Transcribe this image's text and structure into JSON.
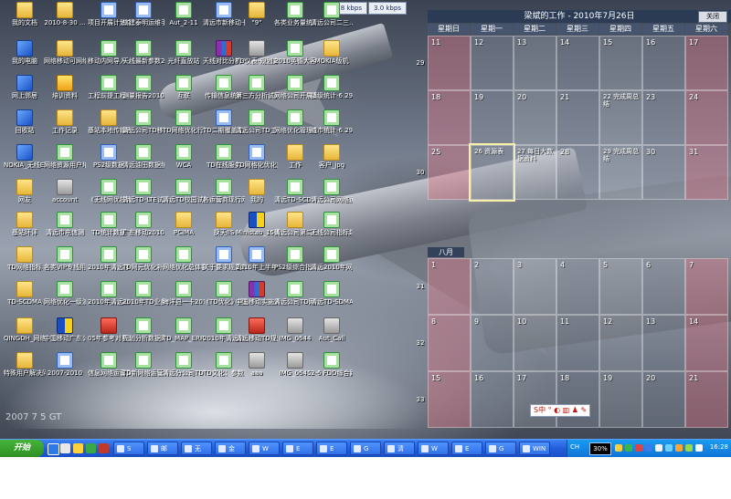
{
  "top_meters": {
    "speed1": "8.8 kbps",
    "speed2": "3.0 kbps"
  },
  "desktop_icons": [
    {
      "label": "我的文档",
      "type": "folder"
    },
    {
      "label": "2010-8-30 ...",
      "type": "folder"
    },
    {
      "label": "项目开展计划中...",
      "type": "word"
    },
    {
      "label": "辖建泰明运维手-01",
      "type": "word"
    },
    {
      "label": "Aut_2-11",
      "type": "excel"
    },
    {
      "label": "清远市新移动卡...",
      "type": "word"
    },
    {
      "label": "\"9\"",
      "type": "folder"
    },
    {
      "label": "各类业务量统计",
      "type": "excel"
    },
    {
      "label": "清远公司二三...",
      "type": "excel"
    },
    {
      "label": "我的电脑",
      "type": "app"
    },
    {
      "label": "网络移动可网络地址",
      "type": "folder"
    },
    {
      "label": "移动内网导入...",
      "type": "excel"
    },
    {
      "label": "天线最新参数2010-",
      "type": "excel"
    },
    {
      "label": "光纤直放站",
      "type": "excel"
    },
    {
      "label": "天线对比分析-2010",
      "type": "rar"
    },
    {
      "label": "TD仪表-规划方案 2",
      "type": "gray"
    },
    {
      "label": "2010英德大客户结果",
      "type": "excel"
    },
    {
      "label": "MOKIA版机",
      "type": "folder"
    },
    {
      "label": "网上邻居",
      "type": "app"
    },
    {
      "label": "培训资料",
      "type": "yellow"
    },
    {
      "label": "工程前提工程—...",
      "type": "excel"
    },
    {
      "label": "测量报告201008...",
      "type": "excel"
    },
    {
      "label": "互联",
      "type": "excel"
    },
    {
      "label": "传输信息统计",
      "type": "excel"
    },
    {
      "label": "第三方分析试分析报",
      "type": "excel"
    },
    {
      "label": "网络公司开展家庭...",
      "type": "excel"
    },
    {
      "label": "镇级统计-6.29用户",
      "type": "excel"
    },
    {
      "label": "回收站",
      "type": "app"
    },
    {
      "label": "工作记录",
      "type": "folder"
    },
    {
      "label": "基站本地传输表",
      "type": "folder"
    },
    {
      "label": "清远公司TD移动学院",
      "type": "excel"
    },
    {
      "label": "TD网络优化行动",
      "type": "excel"
    },
    {
      "label": "TD二期覆盖工程管理",
      "type": "word"
    },
    {
      "label": "清远公司TD工作网格",
      "type": "excel"
    },
    {
      "label": "网络优化管理信息",
      "type": "excel"
    },
    {
      "label": "城市统计-6.29用户",
      "type": "excel"
    },
    {
      "label": "NOKIA_无线E71指导",
      "type": "app"
    },
    {
      "label": "网络资源用户培训",
      "type": "excel"
    },
    {
      "label": "PS2级数据",
      "type": "word"
    },
    {
      "label": "清远油田数据统计",
      "type": "excel"
    },
    {
      "label": "WCA",
      "type": "excel"
    },
    {
      "label": "TD在线服务",
      "type": "excel"
    },
    {
      "label": "TD网格化优化对照",
      "type": "word"
    },
    {
      "label": "工作",
      "type": "folder"
    },
    {
      "label": "客户_jpg",
      "type": "folder"
    },
    {
      "label": "网友",
      "type": "folder"
    },
    {
      "label": "account",
      "type": "gray"
    },
    {
      "label": "《无线网优技术要求",
      "type": "excel"
    },
    {
      "label": "清远TD-LTE试网规划",
      "type": "excel"
    },
    {
      "label": "清远TD校园试网...",
      "type": "excel"
    },
    {
      "label": "各运营商现行网络...",
      "type": "excel"
    },
    {
      "label": "我的",
      "type": "folder"
    },
    {
      "label": "清远TD-SCDMA",
      "type": "excel"
    },
    {
      "label": "清远公司网络运维",
      "type": "excel"
    },
    {
      "label": "基站环评",
      "type": "folder"
    },
    {
      "label": "清远市电信测",
      "type": "excel"
    },
    {
      "label": "TD统计数据",
      "type": "excel"
    },
    {
      "label": "广东移动2010综合",
      "type": "excel"
    },
    {
      "label": "PCIMA",
      "type": "folder"
    },
    {
      "label": "换天IIS",
      "type": "folder"
    },
    {
      "label": "Ministab_15维修中文",
      "type": "flag"
    },
    {
      "label": "清远公司第二代半年终",
      "type": "folder"
    },
    {
      "label": "无线公司指标超标分析",
      "type": "excel"
    },
    {
      "label": "TD网络指标",
      "type": "folder"
    },
    {
      "label": "各类VIP专线用户管理",
      "type": "excel"
    },
    {
      "label": "2010年清远移动资费",
      "type": "excel"
    },
    {
      "label": "TD网元优化补充",
      "type": "excel"
    },
    {
      "label": "网络优化总体要求",
      "type": "excel"
    },
    {
      "label": "关于要求规范有关...",
      "type": "word"
    },
    {
      "label": "2010年上半年总结",
      "type": "word"
    },
    {
      "label": "PS2级综合指标2",
      "type": "excel"
    },
    {
      "label": "清远2010年网络...",
      "type": "excel"
    },
    {
      "label": "TD-SCDMA",
      "type": "folder"
    },
    {
      "label": "网络优化一级演练中",
      "type": "excel"
    },
    {
      "label": "2010年清远公司网络",
      "type": "excel"
    },
    {
      "label": "2010年TD业务指标",
      "type": "excel"
    },
    {
      "label": "海洋县一卡2010",
      "type": "excel"
    },
    {
      "label": "《TD优化》规范",
      "type": "excel"
    },
    {
      "label": "中国移动实施方案",
      "type": "rar"
    },
    {
      "label": "清远公司TD网络...",
      "type": "excel"
    },
    {
      "label": "清远TD-SDMA-0726",
      "type": "excel"
    },
    {
      "label": "QINGDH_网络优化中心",
      "type": "folder"
    },
    {
      "label": "中国移动广东公司...",
      "type": "flag"
    },
    {
      "label": "05年参考对手选择参考",
      "type": "red"
    },
    {
      "label": "规划分析数据网络管理",
      "type": "excel"
    },
    {
      "label": "TD_MAP_ERROR",
      "type": "excel"
    },
    {
      "label": "2010年清远公司资源",
      "type": "excel"
    },
    {
      "label": "清远移动TD规划",
      "type": "red"
    },
    {
      "label": "IMG_0644",
      "type": "gray"
    },
    {
      "label": "Aut_Call",
      "type": "gray"
    },
    {
      "label": "特殊用户解决问题",
      "type": "folder"
    },
    {
      "label": "2007-2010",
      "type": "word"
    },
    {
      "label": "信息网络运营第三批",
      "type": "excel"
    },
    {
      "label": "TD新网络运营第三批",
      "type": "excel"
    },
    {
      "label": "清远分公司TD资源...",
      "type": "excel"
    },
    {
      "label": "TD文化：参数手册",
      "type": "excel"
    },
    {
      "label": "aaa",
      "type": "gray"
    },
    {
      "label": "IMG_0645",
      "type": "gray"
    },
    {
      "label": "2-6 FDD综合路测结果",
      "type": "excel"
    }
  ],
  "calendar": {
    "title": "梁斌的工作 - 2010年7月26日",
    "close_label": "关闭",
    "weekdays": [
      "星期日",
      "星期一",
      "星期二",
      "星期三",
      "星期四",
      "星期五",
      "星期六"
    ],
    "july_weeks": [
      {
        "week": "29",
        "days": [
          "11",
          "12",
          "13",
          "14",
          "15",
          "16",
          "17"
        ]
      },
      {
        "week": "",
        "days": [
          "18",
          "19",
          "20",
          "21",
          "22",
          "23",
          "24"
        ]
      },
      {
        "week": "30",
        "days": [
          "25",
          "26",
          "27",
          "28",
          "29",
          "30",
          "31"
        ]
      }
    ],
    "july_events": {
      "4-22": "22 完成周总结",
      "1-26": "26 资源表",
      "2-27": "27 每日大数据资料",
      "4-29": "29 完成周总结"
    },
    "august_label": "八月",
    "august_weeks": [
      {
        "week": "31",
        "days": [
          "1",
          "2",
          "3",
          "4",
          "5",
          "6",
          "7"
        ]
      },
      {
        "week": "32",
        "days": [
          "8",
          "9",
          "10",
          "11",
          "12",
          "13",
          "14"
        ]
      },
      {
        "week": "33",
        "days": [
          "15",
          "16",
          "17",
          "18",
          "19",
          "20",
          "21"
        ]
      }
    ]
  },
  "ime_bar": "S中 ° ◐ ▥ ♟ ✎",
  "watermark": "2007 7 5 GT",
  "taskbar": {
    "start_label": "开始",
    "tasks": [
      "S",
      "邮",
      "无",
      "金",
      "W",
      "E",
      "E",
      "G",
      "清",
      "W",
      "E",
      "G",
      "WIN"
    ],
    "tray_lang": "CH",
    "tray_pct": "30%",
    "clock": "16:28"
  }
}
